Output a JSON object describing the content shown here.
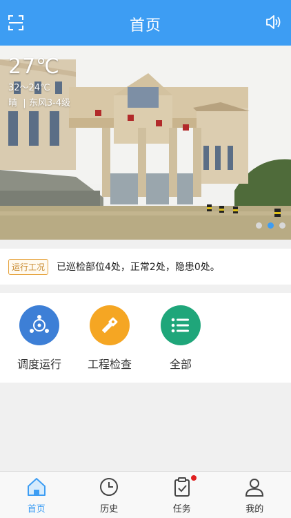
{
  "header": {
    "title": "首页",
    "left_icon": "scan-icon",
    "right_icon": "speaker-icon"
  },
  "weather": {
    "temperature": "27℃",
    "range": "32～24℃",
    "condition": "晴",
    "wind": "东风3-4级"
  },
  "carousel": {
    "total": 3,
    "active_index": 1
  },
  "status": {
    "tag": "运行工况",
    "summary": "已巡检部位4处，正常2处，隐患0处。"
  },
  "menu": [
    {
      "label": "调度运行",
      "icon": "dispatch-icon",
      "color": "#3d7fd6"
    },
    {
      "label": "工程检查",
      "icon": "flashlight-icon",
      "color": "#f5a623"
    },
    {
      "label": "全部",
      "icon": "list-icon",
      "color": "#1fa67a"
    }
  ],
  "tabs": [
    {
      "label": "首页",
      "icon": "home-icon",
      "active": true
    },
    {
      "label": "历史",
      "icon": "clock-icon",
      "active": false
    },
    {
      "label": "任务",
      "icon": "clipboard-icon",
      "active": false,
      "badge": true
    },
    {
      "label": "我的",
      "icon": "user-icon",
      "active": false
    }
  ],
  "colors": {
    "primary": "#3d9df3",
    "tag_border": "#e6a23c",
    "badge": "#e02020"
  }
}
